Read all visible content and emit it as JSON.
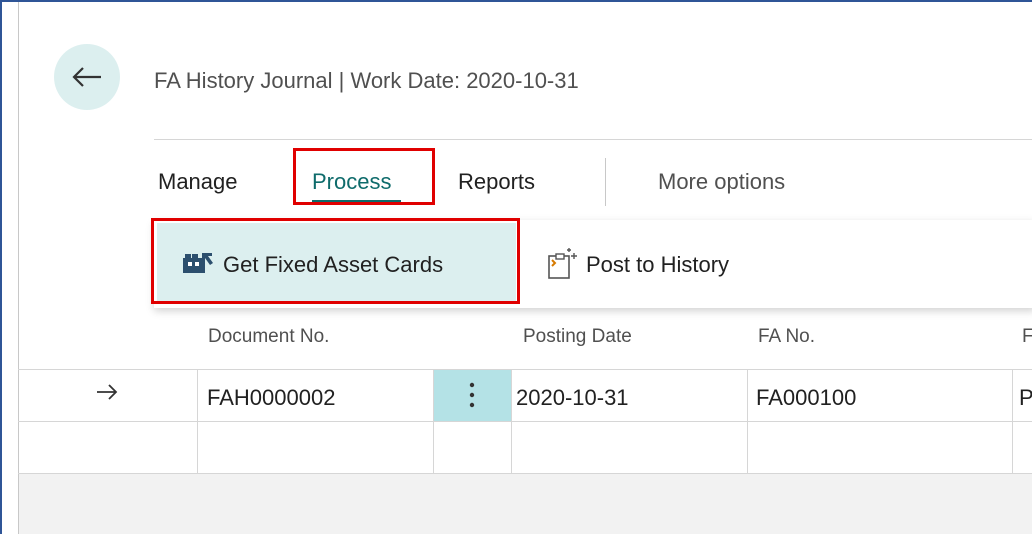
{
  "header": {
    "title": "FA History Journal | Work Date: 2020-10-31"
  },
  "tabs": {
    "manage": "Manage",
    "process": "Process",
    "reports": "Reports",
    "more": "More options"
  },
  "actions": {
    "get_fixed_asset_cards": "Get Fixed Asset Cards",
    "post_to_history": "Post to History"
  },
  "table": {
    "columns": [
      "Document No.",
      "Posting Date",
      "FA No.",
      "F"
    ],
    "rows": [
      {
        "document_no": "FAH0000002",
        "posting_date": "2020-10-31",
        "fa_no": "FA000100",
        "f": "P"
      }
    ]
  },
  "icons": {
    "back": "back-arrow-icon",
    "get_fa_cards": "get-fa-cards-icon",
    "post_history": "post-history-icon",
    "row_indicator": "row-arrow-icon",
    "row_menu": "vertical-ellipsis-icon"
  },
  "colors": {
    "accent": "#0e6b6b",
    "highlight": "#dcefef",
    "ellipsis_cell": "#b4e2e6",
    "annotation_red": "#e00000"
  }
}
